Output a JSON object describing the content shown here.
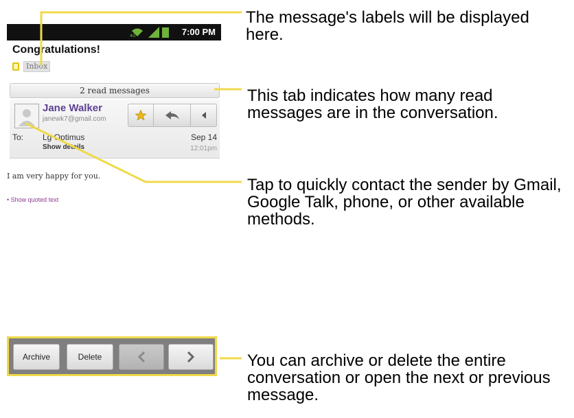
{
  "status_bar": {
    "time": "7:00 PM"
  },
  "message": {
    "subject": "Congratulations!",
    "labels": [
      "Inbox"
    ],
    "read_tab": "2 read messages",
    "sender_name": "Jane Walker",
    "sender_email": "janewk7@gmail.com",
    "to_label": "To:",
    "to_value": "Lg Optimus",
    "show_details": "Show details",
    "date": "Sep 14",
    "time": "12:01pm",
    "body": "I am very happy for you.",
    "show_quoted": "• Show quoted text"
  },
  "bottom_bar": {
    "archive": "Archive",
    "delete": "Delete"
  },
  "callouts": {
    "labels": "The message's labels will be displayed here.",
    "tab": "This tab indicates how many read messages are in the conversation.",
    "contact": "Tap to quickly contact the sender by Gmail, Google Talk, phone, or other available methods.",
    "archive": "You can archive or delete the entire conversation or open the next or previous message."
  },
  "colors": {
    "highlight": "#f0d94a",
    "sender": "#5b3f93",
    "star": "#e8b81a"
  }
}
